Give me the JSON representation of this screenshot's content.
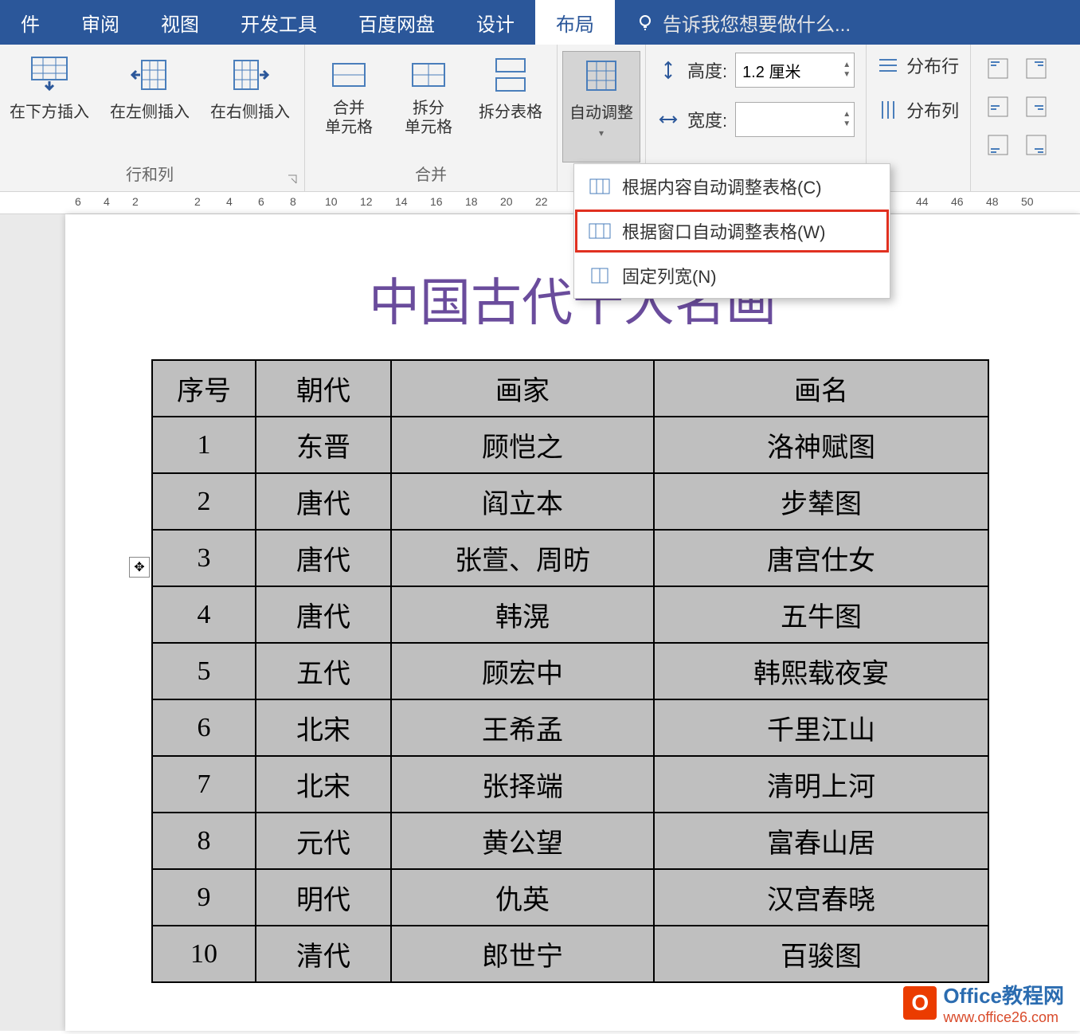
{
  "tabs": {
    "t0": "件",
    "t1": "审阅",
    "t2": "视图",
    "t3": "开发工具",
    "t4": "百度网盘",
    "t5": "设计",
    "t6": "布局"
  },
  "tellme": "告诉我您想要做什么...",
  "ribbon": {
    "rowscols": {
      "label": "行和列",
      "insert_below": "在下方插入",
      "insert_left": "在左侧插入",
      "insert_right": "在右侧插入"
    },
    "merge": {
      "label": "合并",
      "merge_cells": "合并\n单元格",
      "split_cells": "拆分\n单元格",
      "split_table": "拆分表格"
    },
    "autofit": "自动调整",
    "size": {
      "height_label": "高度:",
      "height_value": "1.2 厘米",
      "width_label": "宽度:",
      "width_value": ""
    },
    "dist": {
      "rows": "分布行",
      "cols": "分布列"
    }
  },
  "dropdown": {
    "by_content": "根据内容自动调整表格(C)",
    "by_window": "根据窗口自动调整表格(W)",
    "fixed": "固定列宽(N)"
  },
  "ruler": [
    "6",
    "4",
    "2",
    "2",
    "4",
    "6",
    "8",
    "10",
    "12",
    "14",
    "16",
    "18",
    "20",
    "22",
    "44",
    "46",
    "48",
    "50"
  ],
  "doc": {
    "title": "中国古代十大名画",
    "headers": {
      "h1": "序号",
      "h2": "朝代",
      "h3": "画家",
      "h4": "画名"
    },
    "rows": [
      {
        "n": "1",
        "dynasty": "东晋",
        "artist": "顾恺之",
        "work": "洛神赋图"
      },
      {
        "n": "2",
        "dynasty": "唐代",
        "artist": "阎立本",
        "work": "步辇图"
      },
      {
        "n": "3",
        "dynasty": "唐代",
        "artist": "张萱、周昉",
        "work": "唐宫仕女"
      },
      {
        "n": "4",
        "dynasty": "唐代",
        "artist": "韩滉",
        "work": "五牛图"
      },
      {
        "n": "5",
        "dynasty": "五代",
        "artist": "顾宏中",
        "work": "韩熙载夜宴"
      },
      {
        "n": "6",
        "dynasty": "北宋",
        "artist": "王希孟",
        "work": "千里江山"
      },
      {
        "n": "7",
        "dynasty": "北宋",
        "artist": "张择端",
        "work": "清明上河"
      },
      {
        "n": "8",
        "dynasty": "元代",
        "artist": "黄公望",
        "work": "富春山居"
      },
      {
        "n": "9",
        "dynasty": "明代",
        "artist": "仇英",
        "work": "汉宫春晓"
      },
      {
        "n": "10",
        "dynasty": "清代",
        "artist": "郎世宁",
        "work": "百骏图"
      }
    ]
  },
  "watermark": {
    "brand": "Office教程网",
    "url": "www.office26.com"
  }
}
